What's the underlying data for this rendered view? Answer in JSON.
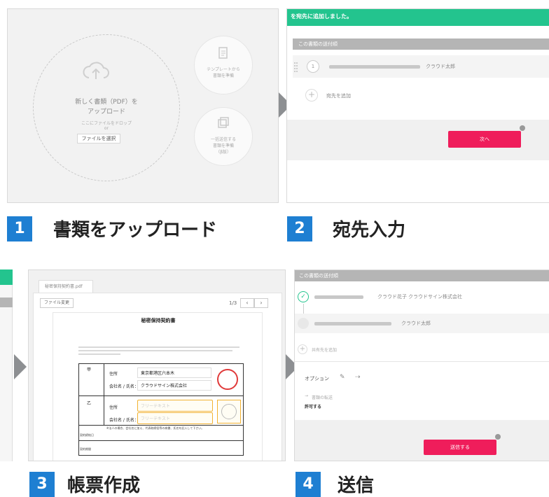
{
  "steps": [
    {
      "number": "1",
      "label": "書類をアップロード"
    },
    {
      "number": "2",
      "label": "宛先入力"
    },
    {
      "number": "3",
      "label": "帳票作成"
    },
    {
      "number": "4",
      "label": "送信"
    }
  ],
  "panel1": {
    "upload_text_line1": "新しく書類（PDF）を",
    "upload_text_line2": "アップロード",
    "drop_hint": "ここにファイルをドロップ",
    "or_text": "or",
    "select_file_button": "ファイルを選択",
    "template_line1": "テンプレートから",
    "template_line2": "書類を準備",
    "bulk_line1": "一括送信する",
    "bulk_line2": "書類を準備",
    "bulk_line3": "（β版）"
  },
  "panel2": {
    "notification": "を宛先に追加しました。",
    "section_header": "この書類の送付順",
    "recipient_order": "1",
    "recipient_name": "クラウド太郎",
    "add_recipient": "宛先を追加",
    "next_button": "次へ"
  },
  "panel3": {
    "file_tab": "秘密保持契約書.pdf",
    "change_file_button": "ファイル変更",
    "page_indicator": "1/3",
    "prev_icon": "chevron-left-icon",
    "next_icon": "chevron-right-icon",
    "doc_title": "秘密保持契約書",
    "party_a": "甲",
    "party_b": "乙",
    "address_label": "住所",
    "company_label": "会社名 / 氏名：",
    "address_value": "東京都港区六本木",
    "company_value": "クラウドサイン株式会社",
    "free_text_1": "フリーテキスト",
    "free_text_2": "フリーテキスト",
    "note": "※法人の場合、会社名に加え、代表取締役等の肩書、氏名を記入して下さい。",
    "row_label_1": "契約締結日",
    "row_label_2": "契約期間"
  },
  "panel4": {
    "section_header": "この書類の送付順",
    "recipient1_name": "クラウド花子",
    "recipient1_company": "クラウドサイン株式会社",
    "recipient2_name": "クラウド太郎",
    "add_cc": "共有先を追加",
    "options_label": "オプション",
    "forward_label": "書類の転送",
    "forward_value": "許可する",
    "send_button": "送信する"
  },
  "colors": {
    "step_blue": "#1e7fd2",
    "green": "#23c48e",
    "pink": "#ef1d5b",
    "field_yellow": "#f2b232",
    "stamp_red": "#e03a3a"
  }
}
